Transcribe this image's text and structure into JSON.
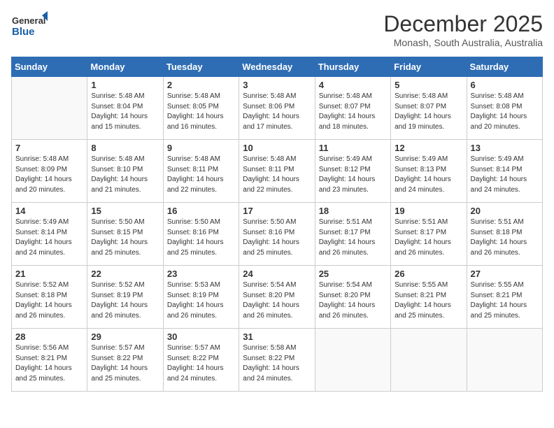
{
  "header": {
    "logo_general": "General",
    "logo_blue": "Blue",
    "month": "December 2025",
    "location": "Monash, South Australia, Australia"
  },
  "weekdays": [
    "Sunday",
    "Monday",
    "Tuesday",
    "Wednesday",
    "Thursday",
    "Friday",
    "Saturday"
  ],
  "weeks": [
    [
      {
        "day": "",
        "lines": []
      },
      {
        "day": "1",
        "lines": [
          "Sunrise: 5:48 AM",
          "Sunset: 8:04 PM",
          "Daylight: 14 hours",
          "and 15 minutes."
        ]
      },
      {
        "day": "2",
        "lines": [
          "Sunrise: 5:48 AM",
          "Sunset: 8:05 PM",
          "Daylight: 14 hours",
          "and 16 minutes."
        ]
      },
      {
        "day": "3",
        "lines": [
          "Sunrise: 5:48 AM",
          "Sunset: 8:06 PM",
          "Daylight: 14 hours",
          "and 17 minutes."
        ]
      },
      {
        "day": "4",
        "lines": [
          "Sunrise: 5:48 AM",
          "Sunset: 8:07 PM",
          "Daylight: 14 hours",
          "and 18 minutes."
        ]
      },
      {
        "day": "5",
        "lines": [
          "Sunrise: 5:48 AM",
          "Sunset: 8:07 PM",
          "Daylight: 14 hours",
          "and 19 minutes."
        ]
      },
      {
        "day": "6",
        "lines": [
          "Sunrise: 5:48 AM",
          "Sunset: 8:08 PM",
          "Daylight: 14 hours",
          "and 20 minutes."
        ]
      }
    ],
    [
      {
        "day": "7",
        "lines": [
          "Sunrise: 5:48 AM",
          "Sunset: 8:09 PM",
          "Daylight: 14 hours",
          "and 20 minutes."
        ]
      },
      {
        "day": "8",
        "lines": [
          "Sunrise: 5:48 AM",
          "Sunset: 8:10 PM",
          "Daylight: 14 hours",
          "and 21 minutes."
        ]
      },
      {
        "day": "9",
        "lines": [
          "Sunrise: 5:48 AM",
          "Sunset: 8:11 PM",
          "Daylight: 14 hours",
          "and 22 minutes."
        ]
      },
      {
        "day": "10",
        "lines": [
          "Sunrise: 5:48 AM",
          "Sunset: 8:11 PM",
          "Daylight: 14 hours",
          "and 22 minutes."
        ]
      },
      {
        "day": "11",
        "lines": [
          "Sunrise: 5:49 AM",
          "Sunset: 8:12 PM",
          "Daylight: 14 hours",
          "and 23 minutes."
        ]
      },
      {
        "day": "12",
        "lines": [
          "Sunrise: 5:49 AM",
          "Sunset: 8:13 PM",
          "Daylight: 14 hours",
          "and 24 minutes."
        ]
      },
      {
        "day": "13",
        "lines": [
          "Sunrise: 5:49 AM",
          "Sunset: 8:14 PM",
          "Daylight: 14 hours",
          "and 24 minutes."
        ]
      }
    ],
    [
      {
        "day": "14",
        "lines": [
          "Sunrise: 5:49 AM",
          "Sunset: 8:14 PM",
          "Daylight: 14 hours",
          "and 24 minutes."
        ]
      },
      {
        "day": "15",
        "lines": [
          "Sunrise: 5:50 AM",
          "Sunset: 8:15 PM",
          "Daylight: 14 hours",
          "and 25 minutes."
        ]
      },
      {
        "day": "16",
        "lines": [
          "Sunrise: 5:50 AM",
          "Sunset: 8:16 PM",
          "Daylight: 14 hours",
          "and 25 minutes."
        ]
      },
      {
        "day": "17",
        "lines": [
          "Sunrise: 5:50 AM",
          "Sunset: 8:16 PM",
          "Daylight: 14 hours",
          "and 25 minutes."
        ]
      },
      {
        "day": "18",
        "lines": [
          "Sunrise: 5:51 AM",
          "Sunset: 8:17 PM",
          "Daylight: 14 hours",
          "and 26 minutes."
        ]
      },
      {
        "day": "19",
        "lines": [
          "Sunrise: 5:51 AM",
          "Sunset: 8:17 PM",
          "Daylight: 14 hours",
          "and 26 minutes."
        ]
      },
      {
        "day": "20",
        "lines": [
          "Sunrise: 5:51 AM",
          "Sunset: 8:18 PM",
          "Daylight: 14 hours",
          "and 26 minutes."
        ]
      }
    ],
    [
      {
        "day": "21",
        "lines": [
          "Sunrise: 5:52 AM",
          "Sunset: 8:18 PM",
          "Daylight: 14 hours",
          "and 26 minutes."
        ]
      },
      {
        "day": "22",
        "lines": [
          "Sunrise: 5:52 AM",
          "Sunset: 8:19 PM",
          "Daylight: 14 hours",
          "and 26 minutes."
        ]
      },
      {
        "day": "23",
        "lines": [
          "Sunrise: 5:53 AM",
          "Sunset: 8:19 PM",
          "Daylight: 14 hours",
          "and 26 minutes."
        ]
      },
      {
        "day": "24",
        "lines": [
          "Sunrise: 5:54 AM",
          "Sunset: 8:20 PM",
          "Daylight: 14 hours",
          "and 26 minutes."
        ]
      },
      {
        "day": "25",
        "lines": [
          "Sunrise: 5:54 AM",
          "Sunset: 8:20 PM",
          "Daylight: 14 hours",
          "and 26 minutes."
        ]
      },
      {
        "day": "26",
        "lines": [
          "Sunrise: 5:55 AM",
          "Sunset: 8:21 PM",
          "Daylight: 14 hours",
          "and 25 minutes."
        ]
      },
      {
        "day": "27",
        "lines": [
          "Sunrise: 5:55 AM",
          "Sunset: 8:21 PM",
          "Daylight: 14 hours",
          "and 25 minutes."
        ]
      }
    ],
    [
      {
        "day": "28",
        "lines": [
          "Sunrise: 5:56 AM",
          "Sunset: 8:21 PM",
          "Daylight: 14 hours",
          "and 25 minutes."
        ]
      },
      {
        "day": "29",
        "lines": [
          "Sunrise: 5:57 AM",
          "Sunset: 8:22 PM",
          "Daylight: 14 hours",
          "and 25 minutes."
        ]
      },
      {
        "day": "30",
        "lines": [
          "Sunrise: 5:57 AM",
          "Sunset: 8:22 PM",
          "Daylight: 14 hours",
          "and 24 minutes."
        ]
      },
      {
        "day": "31",
        "lines": [
          "Sunrise: 5:58 AM",
          "Sunset: 8:22 PM",
          "Daylight: 14 hours",
          "and 24 minutes."
        ]
      },
      {
        "day": "",
        "lines": []
      },
      {
        "day": "",
        "lines": []
      },
      {
        "day": "",
        "lines": []
      }
    ]
  ]
}
